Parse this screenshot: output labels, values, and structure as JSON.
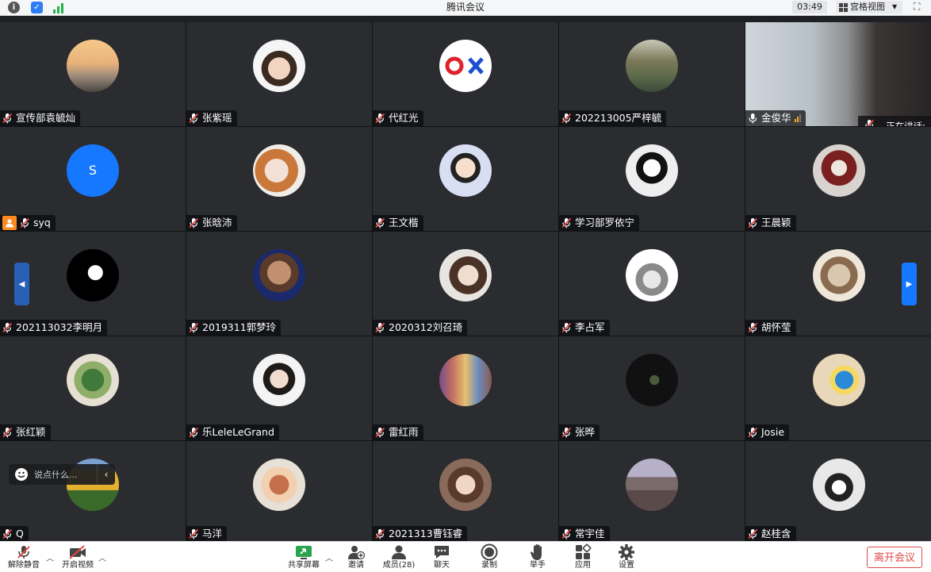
{
  "window": {
    "title": "腾讯会议",
    "time": "03:49",
    "view_mode": "宫格视图"
  },
  "participants": [
    {
      "name": "宣传部袁毓灿",
      "avatar": "sunset-photo"
    },
    {
      "name": "张紫瑶",
      "avatar": "girl-photo"
    },
    {
      "name": "代红光",
      "avatar": "ox-logo"
    },
    {
      "name": "202213005严梓毓",
      "avatar": "pond-photo"
    },
    {
      "name": "金俊华",
      "avatar": "camera-video"
    },
    {
      "name": "syq",
      "avatar": "letter-avatar",
      "letter": "S",
      "host": true
    },
    {
      "name": "张晗沛",
      "avatar": "anime-girl"
    },
    {
      "name": "王文楷",
      "avatar": "cartoon-boy"
    },
    {
      "name": "学习部罗依宁",
      "avatar": "manga-boy"
    },
    {
      "name": "王晨颖",
      "avatar": "drawing-girl"
    },
    {
      "name": "202113032李明月",
      "avatar": "black-white-art"
    },
    {
      "name": "2019311郭梦玲",
      "avatar": "braids-photo"
    },
    {
      "name": "2020312刘召琦",
      "avatar": "woman-portrait"
    },
    {
      "name": "李占军",
      "avatar": "totoro"
    },
    {
      "name": "胡怀莹",
      "avatar": "sketch-photo"
    },
    {
      "name": "张红颖",
      "avatar": "plant-photo"
    },
    {
      "name": "乐LeleLeGrand",
      "avatar": "woman-portrait-2"
    },
    {
      "name": "雷红雨",
      "avatar": "crowd-photo"
    },
    {
      "name": "张晔",
      "avatar": "dark-photo"
    },
    {
      "name": "Josie",
      "avatar": "doraemon"
    },
    {
      "name": "Q",
      "avatar": "flower-field"
    },
    {
      "name": "马洋",
      "avatar": "cake-photo"
    },
    {
      "name": "2021313曹钰睿",
      "avatar": "girl-portrait"
    },
    {
      "name": "常宇佳",
      "avatar": "tower-photo"
    },
    {
      "name": "赵桂含",
      "avatar": "cat-photo"
    }
  ],
  "speaking": {
    "label": "正在讲话:"
  },
  "chat": {
    "placeholder": "说点什么..."
  },
  "toolbar": {
    "unmute": "解除静音",
    "start_video": "开启视频",
    "share_screen": "共享屏幕",
    "invite": "邀请",
    "members": "成员(28)",
    "chat": "聊天",
    "record": "录制",
    "raise_hand": "举手",
    "apps": "应用",
    "settings": "设置",
    "leave": "离开会议"
  },
  "colors": {
    "accent": "#1677ff",
    "leave": "#e2484a",
    "host": "#ff8a1f",
    "mic_muted": "#e2484a"
  }
}
